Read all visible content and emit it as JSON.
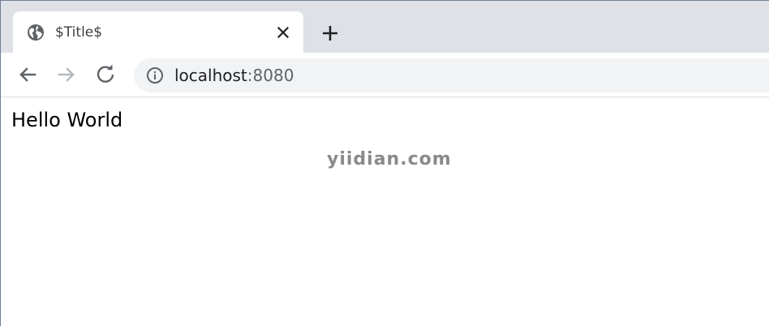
{
  "browser": {
    "tab": {
      "title": "$Title$",
      "favicon": "globe-icon"
    },
    "address_bar": {
      "host": "localhost",
      "port": ":8080",
      "site_info_icon": "info-icon"
    },
    "nav": {
      "back_icon": "arrow-left-icon",
      "forward_icon": "arrow-right-icon",
      "reload_icon": "reload-icon",
      "new_tab_icon": "plus-icon",
      "close_tab_icon": "close-icon"
    },
    "colors": {
      "tabstrip_bg": "#dee1e6",
      "omnibox_bg": "#f1f3f4",
      "icon_active": "#5f6368",
      "icon_disabled": "#b6b9bd"
    }
  },
  "page": {
    "body_text": "Hello World"
  },
  "watermark": {
    "text": "yiidian.com"
  }
}
